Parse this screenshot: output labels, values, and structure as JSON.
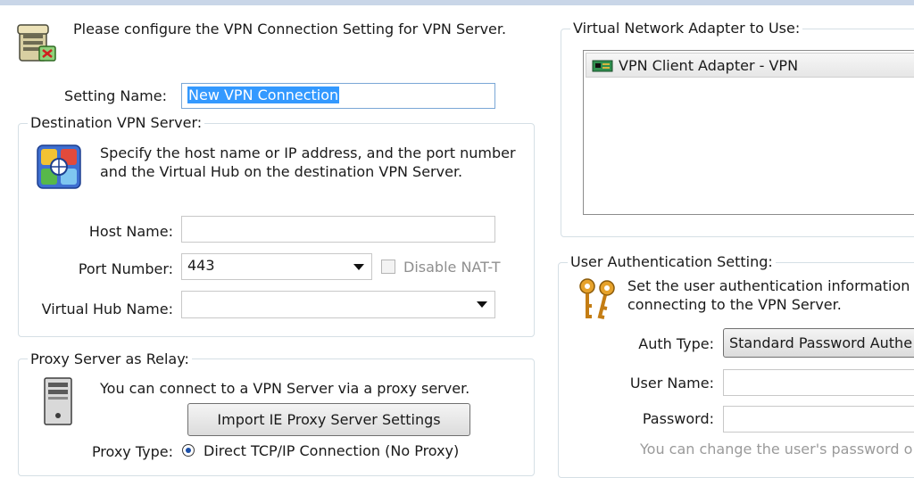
{
  "intro": {
    "text": "Please configure the VPN Connection Setting for VPN Server.",
    "icon": "server-config-icon"
  },
  "setting_name": {
    "label": "Setting Name:",
    "value": "New VPN Connection"
  },
  "destination": {
    "legend": "Destination VPN Server:",
    "icon": "network-globe-icon",
    "description_line1": "Specify the host name or IP address, and the port number",
    "description_line2": "and the Virtual Hub on the destination VPN Server.",
    "host_label": "Host Name:",
    "host_value": "",
    "port_label": "Port Number:",
    "port_value": "443",
    "disable_nat_label": "Disable NAT-T",
    "hub_label": "Virtual Hub Name:",
    "hub_value": ""
  },
  "proxy": {
    "legend": "Proxy Server as Relay:",
    "icon": "computer-tower-icon",
    "description": "You can connect to a VPN Server via a proxy server.",
    "import_button": "Import IE Proxy Server Settings",
    "type_label": "Proxy Type:",
    "type_option": "Direct TCP/IP Connection (No Proxy)"
  },
  "adapter": {
    "legend": "Virtual Network Adapter to Use:",
    "items": [
      "VPN Client Adapter - VPN"
    ],
    "item_icon": "network-card-icon"
  },
  "auth": {
    "legend": "User Authentication Setting:",
    "icon": "keys-icon",
    "description_line1": "Set the user authentication information t",
    "description_line2": "connecting to the VPN Server.",
    "type_label": "Auth Type:",
    "type_value": "Standard Password Authe",
    "user_label": "User Name:",
    "user_value": "",
    "password_label": "Password:",
    "password_value": "",
    "hint": "You can change the user's password o"
  }
}
